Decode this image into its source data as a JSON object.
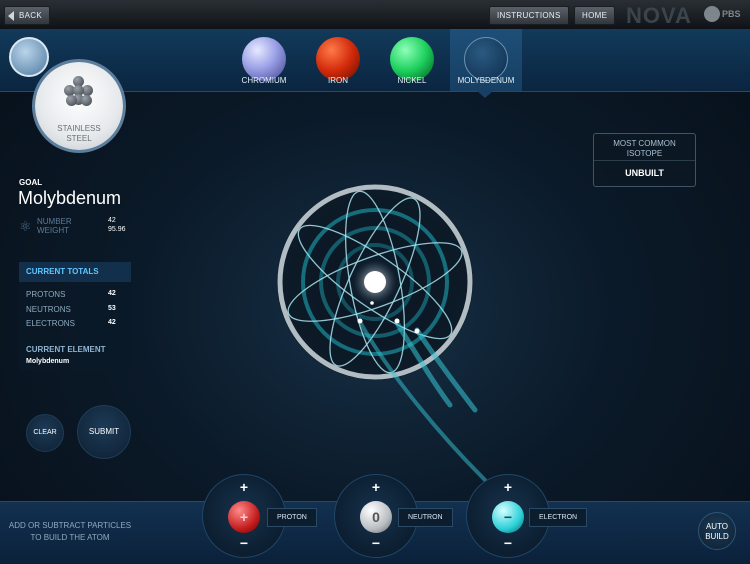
{
  "topbar": {
    "back_label": "BACK",
    "instructions_label": "INSTRUCTIONS",
    "home_label": "HOME",
    "brand": "NOVA",
    "pbs": "PBS"
  },
  "elements": [
    {
      "label": "CHROMIUM",
      "color": "#9aa0e6"
    },
    {
      "label": "IRON",
      "color": "#d22a0a"
    },
    {
      "label": "NICKEL",
      "color": "#1ccf5c"
    },
    {
      "label": "MOLYBDENUM",
      "color": "#163a5c",
      "selected": true
    }
  ],
  "alloy": {
    "label_line1": "STAINLESS",
    "label_line2": "STEEL"
  },
  "goal": {
    "heading": "GOAL",
    "name": "Molybdenum",
    "number_label": "NUMBER",
    "number_value": "42",
    "weight_label": "WEIGHT",
    "weight_value": "95.96"
  },
  "totals": {
    "heading": "CURRENT TOTALS",
    "protons_label": "PROTONS",
    "protons": "42",
    "neutrons_label": "NEUTRONS",
    "neutrons": "53",
    "electrons_label": "ELECTRONS",
    "electrons": "42",
    "current_element_label": "CURRENT ELEMENT",
    "current_element": "Molybdenum"
  },
  "buttons": {
    "clear": "CLEAR",
    "submit": "SUBMIT",
    "auto_line1": "AUTO",
    "auto_line2": "BUILD"
  },
  "isotope": {
    "title_line1": "MOST COMMON",
    "title_line2": "ISOTOPE",
    "value": "UNBUILT"
  },
  "controls": {
    "hint_line1": "ADD OR SUBTRACT PARTICLES",
    "hint_line2": "TO BUILD THE ATOM",
    "plus": "+",
    "minus": "−",
    "proton_label": "PROTON",
    "proton_symbol": "+",
    "neutron_label": "NEUTRON",
    "neutron_symbol": "0",
    "electron_label": "ELECTRON",
    "electron_symbol": "−"
  },
  "colors": {
    "accent": "#5fc7ff",
    "proton": "#c41d1d",
    "electron": "#2bd0d8",
    "neutron": "#b9bec3"
  }
}
